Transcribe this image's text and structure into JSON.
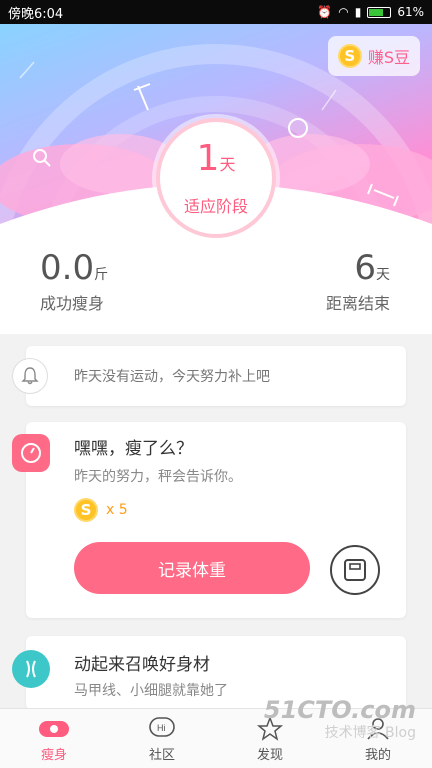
{
  "status_bar": {
    "time": "傍晚6:04",
    "battery": "61%"
  },
  "header": {
    "earn_button": {
      "coin": "S",
      "label": "赚S豆"
    },
    "day_count": "1",
    "day_unit": "天",
    "stage": "适应阶段"
  },
  "stats": {
    "weight_loss": {
      "value": "0.0",
      "unit": "斤",
      "label": "成功瘦身"
    },
    "days_remaining": {
      "value": "6",
      "unit": "天",
      "label": "距离结束"
    }
  },
  "reminder": {
    "icon": "bell-icon",
    "text": "昨天没有运动，今天努力补上吧"
  },
  "weigh_card": {
    "icon": "scale-dial-icon",
    "accent": "#ff6b86",
    "title": "嘿嘿，瘦了么？",
    "subtitle": "昨天的努力，秤会告诉你。",
    "reward_coin": "S",
    "reward_multiplier": "x 5",
    "record_button": "记录体重"
  },
  "summon_card": {
    "icon": "body-shape-icon",
    "title": "动起来召唤好身材",
    "subtitle": "马甲线、小细腿就靠她了"
  },
  "tabs": [
    {
      "label": "瘦身",
      "icon": "cat-collar-icon",
      "active": true
    },
    {
      "label": "社区",
      "icon": "chat-hi-icon",
      "active": false
    },
    {
      "label": "发现",
      "icon": "star-icon",
      "active": false
    },
    {
      "label": "我的",
      "icon": "user-icon",
      "active": false
    }
  ],
  "watermark": {
    "brand": "51CTO.com",
    "sub": "技术博客",
    "blog": "Blog"
  }
}
